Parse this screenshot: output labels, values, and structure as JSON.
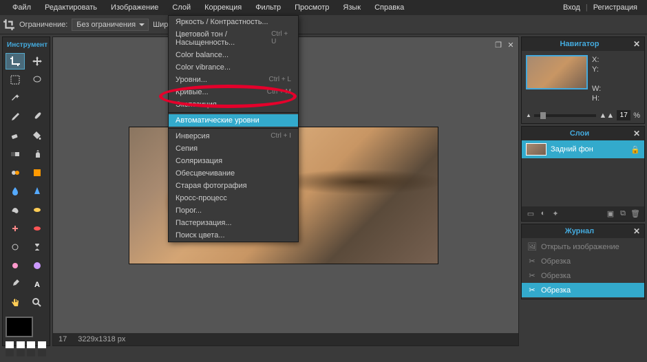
{
  "menubar": {
    "items": [
      "Файл",
      "Редактировать",
      "Изображение",
      "Слой",
      "Коррекция",
      "Фильтр",
      "Просмотр",
      "Язык",
      "Справка"
    ],
    "login": "Вход",
    "register": "Регистрация"
  },
  "optbar": {
    "constraint_label": "Ограничение:",
    "constraint_value": "Без ограничения",
    "width_label": "Шир"
  },
  "tools_title": "Инструмент",
  "dropdown": {
    "items": [
      {
        "label": "Яркость / Контрастность...",
        "shortcut": ""
      },
      {
        "label": "Цветовой тон / Насыщенность...",
        "shortcut": "Ctrl + U"
      },
      {
        "label": "Color balance...",
        "shortcut": ""
      },
      {
        "label": "Color vibrance...",
        "shortcut": ""
      },
      {
        "label": "Уровни...",
        "shortcut": "Ctrl + L"
      },
      {
        "label": "Кривые...",
        "shortcut": "Ctrl + M"
      },
      {
        "label": "Экспозиция",
        "shortcut": ""
      }
    ],
    "highlighted": {
      "label": "Автоматические уровни",
      "shortcut": ""
    },
    "items2": [
      {
        "label": "Инверсия",
        "shortcut": "Ctrl + I"
      },
      {
        "label": "Сепия",
        "shortcut": ""
      },
      {
        "label": "Соляризация",
        "shortcut": ""
      },
      {
        "label": "Обесцвечивание",
        "shortcut": ""
      },
      {
        "label": "Старая фотография",
        "shortcut": ""
      },
      {
        "label": "Кросс-процесс",
        "shortcut": ""
      },
      {
        "label": "Порог...",
        "shortcut": ""
      },
      {
        "label": "Пастеризация...",
        "shortcut": ""
      },
      {
        "label": "Поиск цвета...",
        "shortcut": ""
      }
    ]
  },
  "navigator": {
    "title": "Навигатор",
    "x": "X:",
    "y": "Y:",
    "w": "W:",
    "h": "H:",
    "zoom": "17",
    "pct": "%"
  },
  "layers": {
    "title": "Слои",
    "bg": "Задний фон"
  },
  "history": {
    "title": "Журнал",
    "items": [
      "Открыть изображение",
      "Обрезка",
      "Обрезка",
      "Обрезка"
    ]
  },
  "status": {
    "zoom": "17",
    "dims": "3229x1318 px"
  },
  "icons": {
    "mountain_small": "▲",
    "mountain_big": "▲▲",
    "lock": "🔒",
    "close": "✕",
    "restore": "❐"
  }
}
